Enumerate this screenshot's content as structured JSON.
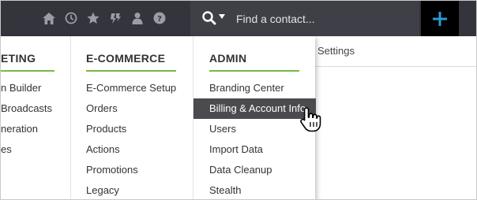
{
  "topbar": {
    "icons": [
      "home-icon",
      "clock-icon",
      "star-icon",
      "pipeline-icon",
      "person-icon",
      "help-icon"
    ],
    "search": {
      "placeholder": "Find a contact..."
    },
    "add_button_icon": "plus-icon",
    "colors": {
      "bar": "#34343c",
      "search": "#3f3f48",
      "accent": "#2b9ad6"
    }
  },
  "settings_label": "Settings",
  "menu": {
    "accent": "#77b943",
    "columns": [
      {
        "title": "ETING",
        "items": [
          "n Builder",
          "Broadcasts",
          "neration",
          "es"
        ]
      },
      {
        "title": "E-COMMERCE",
        "items": [
          "E-Commerce Setup",
          "Orders",
          "Products",
          "Actions",
          "Promotions",
          "Legacy"
        ]
      },
      {
        "title": "ADMIN",
        "items": [
          "Branding Center",
          "Billing & Account Info",
          "Users",
          "Import Data",
          "Data Cleanup",
          "Stealth"
        ],
        "active_item": "Billing & Account Info"
      }
    ]
  }
}
